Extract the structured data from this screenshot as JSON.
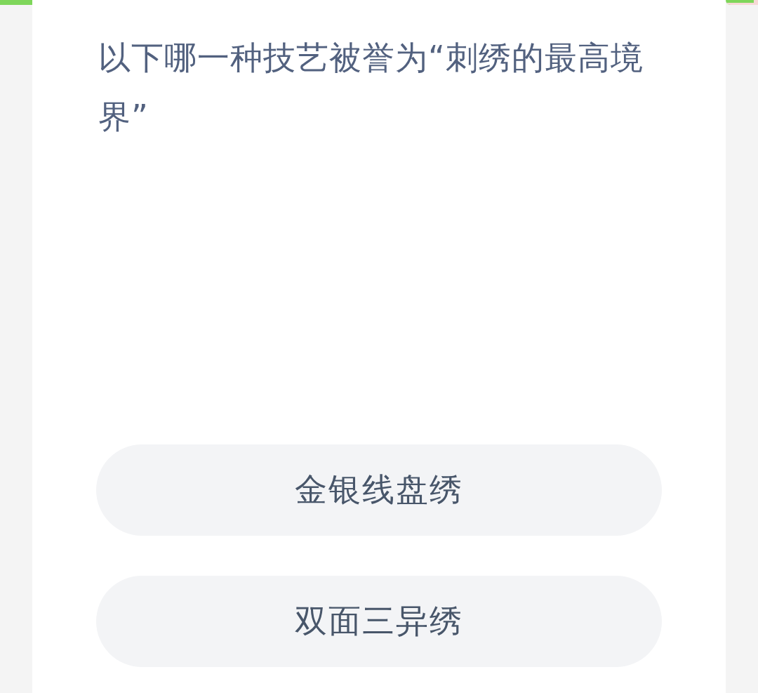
{
  "question": "以下哪一种技艺被誉为“刺绣的最高境界”",
  "options": [
    {
      "label": "金银线盘绣"
    },
    {
      "label": "双面三异绣"
    }
  ]
}
